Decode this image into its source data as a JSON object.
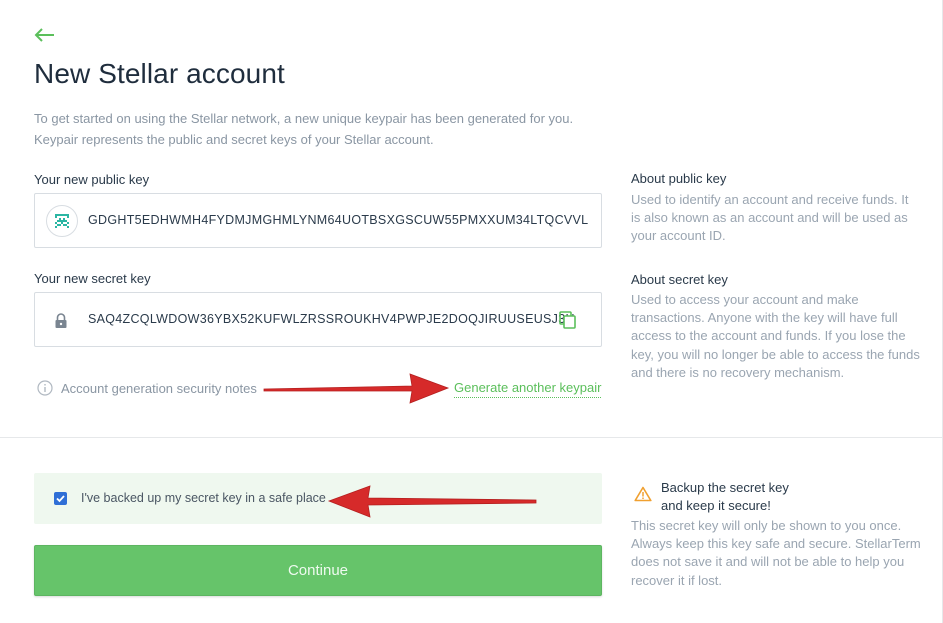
{
  "page": {
    "title": "New Stellar account",
    "intro_line1": "To get started on using the Stellar network, a new unique keypair has been generated for you.",
    "intro_line2": "Keypair represents the public and secret keys of your Stellar account."
  },
  "public_key": {
    "label": "Your new public key",
    "value": "GDGHT5EDHWMH4FYDMJMGHMLYNM64UOTBSXGSCUW55PMXXUM34LTQCVVL",
    "icon": "identicon"
  },
  "secret_key": {
    "label": "Your new secret key",
    "value": "SAQ4ZCQLWDOW36YBX52KUFWLZRSSROUKHV4PWPJE2DOQJIRUUSEUSJ3H",
    "icon": "lock-icon",
    "copy_icon": "copy-icon"
  },
  "links": {
    "security_notes": "Account generation security notes",
    "generate_another": "Generate another keypair"
  },
  "sidebar": {
    "public_title": "About public key",
    "public_text": "Used to identify an account and receive funds. It is also known as an account and will be used as your account ID.",
    "secret_title": "About secret key",
    "secret_text": "Used to access your account and make transactions. Anyone with the key will have full access to the account and funds. If you lose the key, you will no longer be able to access the funds and there is no recovery mechanism.",
    "backup_title_line1": "Backup the secret key",
    "backup_title_line2": "and keep it secure!",
    "backup_text": "This secret key will only be shown to you once. Always keep this key safe and secure. StellarTerm does not save it and will not be able to help you recover it if lost."
  },
  "confirm": {
    "label": "I've backed up my secret key in a safe place",
    "checked": true
  },
  "buttons": {
    "continue": "Continue"
  },
  "colors": {
    "accent_green": "#5bbf5b",
    "button_green": "#66c46a",
    "checkbox_blue": "#2f6fd6",
    "warning_orange": "#f0a030",
    "annotation_red": "#d62a2a"
  }
}
